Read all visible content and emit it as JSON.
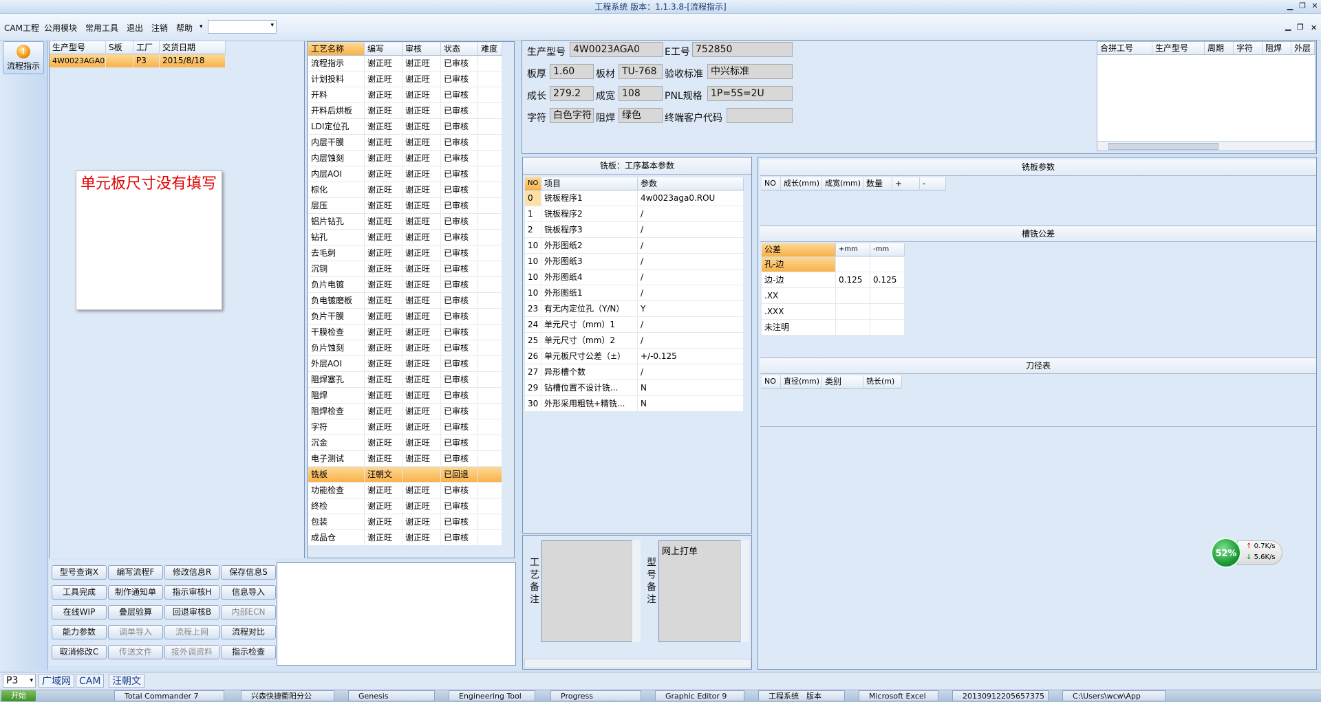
{
  "window": {
    "title": "工程系统 版本：1.1.3.8-[流程指示]"
  },
  "menu": [
    "CAM工程",
    "公用模块",
    "常用工具",
    "退出",
    "注销",
    "帮助"
  ],
  "sidebar": {
    "button": "流程指示"
  },
  "order_grid": {
    "columns": [
      "生产型号",
      "S板",
      "工厂",
      "交货日期"
    ],
    "rows": [
      [
        "4W0023AGA0",
        "",
        "P3",
        "2015/8/18"
      ]
    ]
  },
  "sticky_note": "单元板尺寸没有填写",
  "process_grid": {
    "columns": [
      "工艺名称",
      "编写",
      "审核",
      "状态",
      "难度"
    ],
    "rows": [
      [
        "流程指示",
        "谢正旺",
        "谢正旺",
        "已审核",
        ""
      ],
      [
        "计划投料",
        "谢正旺",
        "谢正旺",
        "已审核",
        ""
      ],
      [
        "开料",
        "谢正旺",
        "谢正旺",
        "已审核",
        ""
      ],
      [
        "开料后烘板",
        "谢正旺",
        "谢正旺",
        "已审核",
        ""
      ],
      [
        "LDI定位孔",
        "谢正旺",
        "谢正旺",
        "已审核",
        ""
      ],
      [
        "内层干膜",
        "谢正旺",
        "谢正旺",
        "已审核",
        ""
      ],
      [
        "内层蚀刻",
        "谢正旺",
        "谢正旺",
        "已审核",
        ""
      ],
      [
        "内层AOI",
        "谢正旺",
        "谢正旺",
        "已审核",
        ""
      ],
      [
        "棕化",
        "谢正旺",
        "谢正旺",
        "已审核",
        ""
      ],
      [
        "层压",
        "谢正旺",
        "谢正旺",
        "已审核",
        ""
      ],
      [
        "铝片钻孔",
        "谢正旺",
        "谢正旺",
        "已审核",
        ""
      ],
      [
        "钻孔",
        "谢正旺",
        "谢正旺",
        "已审核",
        ""
      ],
      [
        "去毛刺",
        "谢正旺",
        "谢正旺",
        "已审核",
        ""
      ],
      [
        "沉铜",
        "谢正旺",
        "谢正旺",
        "已审核",
        ""
      ],
      [
        "负片电镀",
        "谢正旺",
        "谢正旺",
        "已审核",
        ""
      ],
      [
        "负电镀磨板",
        "谢正旺",
        "谢正旺",
        "已审核",
        ""
      ],
      [
        "负片干膜",
        "谢正旺",
        "谢正旺",
        "已审核",
        ""
      ],
      [
        "干膜检查",
        "谢正旺",
        "谢正旺",
        "已审核",
        ""
      ],
      [
        "负片蚀刻",
        "谢正旺",
        "谢正旺",
        "已审核",
        ""
      ],
      [
        "外层AOI",
        "谢正旺",
        "谢正旺",
        "已审核",
        ""
      ],
      [
        "阻焊塞孔",
        "谢正旺",
        "谢正旺",
        "已审核",
        ""
      ],
      [
        "阻焊",
        "谢正旺",
        "谢正旺",
        "已审核",
        ""
      ],
      [
        "阻焊检查",
        "谢正旺",
        "谢正旺",
        "已审核",
        ""
      ],
      [
        "字符",
        "谢正旺",
        "谢正旺",
        "已审核",
        ""
      ],
      [
        "沉金",
        "谢正旺",
        "谢正旺",
        "已审核",
        ""
      ],
      [
        "电子测试",
        "谢正旺",
        "谢正旺",
        "已审核",
        ""
      ],
      [
        "铣板",
        "汪朝文",
        "",
        "已回退",
        ""
      ],
      [
        "功能检查",
        "谢正旺",
        "谢正旺",
        "已审核",
        ""
      ],
      [
        "终检",
        "谢正旺",
        "谢正旺",
        "已审核",
        ""
      ],
      [
        "包装",
        "谢正旺",
        "谢正旺",
        "已审核",
        ""
      ],
      [
        "成品仓",
        "谢正旺",
        "谢正旺",
        "已审核",
        ""
      ]
    ]
  },
  "buttons": [
    [
      "型号查询X",
      "编写流程F",
      "修改信息R",
      "保存信息S"
    ],
    [
      "工具完成",
      "制作通知单",
      "指示审核H",
      "信息导入"
    ],
    [
      "在线WIP",
      "叠层验算",
      "回退审核B",
      "内部ECN"
    ],
    [
      "能力参数",
      "调单导入",
      "流程上网",
      "流程对比"
    ],
    [
      "取消修改C",
      "传送文件",
      "接外调资料",
      "指示检查"
    ]
  ],
  "info": {
    "prod_model_lbl": "生产型号",
    "prod_model": "4W0023AGA0",
    "e_no_lbl": "E工号",
    "e_no": "752850",
    "thick_lbl": "板厚",
    "thick": "1.60",
    "material_lbl": "板材",
    "material": "TU-768",
    "std_lbl": "验收标准",
    "std": "中兴标准",
    "length_lbl": "成长",
    "length": "279.2",
    "width_lbl": "成宽",
    "width": "108",
    "pnl_lbl": "PNL规格",
    "pnl": "1P=5S=2U",
    "char_lbl": "字符",
    "char": "白色字符",
    "mask_lbl": "阻焊",
    "mask": "绿色",
    "client_lbl": "终端客户代码",
    "client": ""
  },
  "merge_grid": {
    "columns": [
      "合拼工号",
      "生产型号",
      "周期",
      "字符",
      "阻焊",
      "外层"
    ]
  },
  "mill_params": {
    "title": "铣板：工序基本参数",
    "columns": [
      "NO",
      "项目",
      "参数"
    ],
    "rows": [
      [
        "0",
        "铣板程序1",
        "4w0023aga0.ROU"
      ],
      [
        "1",
        "铣板程序2",
        "/"
      ],
      [
        "2",
        "铣板程序3",
        "/"
      ],
      [
        "10",
        "外形图纸2",
        "/"
      ],
      [
        "10",
        "外形图纸3",
        "/"
      ],
      [
        "10",
        "外形图纸4",
        "/"
      ],
      [
        "10",
        "外形图纸1",
        "/"
      ],
      [
        "23",
        "有无内定位孔（Y/N）",
        "Y"
      ],
      [
        "24",
        "单元尺寸（mm）1",
        "/"
      ],
      [
        "25",
        "单元尺寸（mm）2",
        "/"
      ],
      [
        "26",
        "单元板尺寸公差（±）",
        "+/-0.125"
      ],
      [
        "27",
        "异形槽个数",
        "/"
      ],
      [
        "29",
        "钻槽位置不设计铣...",
        "N"
      ],
      [
        "30",
        "外形采用粗铣+精铣...",
        "N"
      ]
    ]
  },
  "process_memo_lbl": "工艺备注",
  "model_memo_lbl": "型号备注",
  "model_memo": "网上打单",
  "mill_board": {
    "title": "铣板参数",
    "columns": [
      "NO",
      "成长(mm)",
      "成宽(mm)",
      "数量",
      "+",
      "-"
    ]
  },
  "slot_tol": {
    "title": "槽铣公差",
    "columns": [
      "公差",
      "+mm",
      "-mm"
    ],
    "rows": [
      [
        "孔-边",
        "",
        ""
      ],
      [
        "边-边",
        "0.125",
        "0.125"
      ],
      [
        ".XX",
        "",
        ""
      ],
      [
        ".XXX",
        "",
        ""
      ],
      [
        "未注明",
        "",
        ""
      ]
    ]
  },
  "tool_table": {
    "title": "刀径表",
    "columns": [
      "NO",
      "直径(mm)",
      "类别",
      "铣长(m)"
    ]
  },
  "statusbar": {
    "factory": "P3",
    "tabs": [
      "广域网",
      "CAM",
      "汪朝文"
    ]
  },
  "taskbar": {
    "start": "开始",
    "items": [
      "Total Commander 7",
      "兴森快捷衢阳分公",
      "Genesis",
      "Engineering Tool",
      "Progress",
      "Graphic Editor 9",
      "工程系统　版本",
      "Microsoft Excel",
      "20130912205657375",
      "C:\\Users\\wcw\\App"
    ]
  },
  "netmeter": {
    "percent": "52%",
    "up": "0.7K/s",
    "down": "5.6K/s"
  }
}
